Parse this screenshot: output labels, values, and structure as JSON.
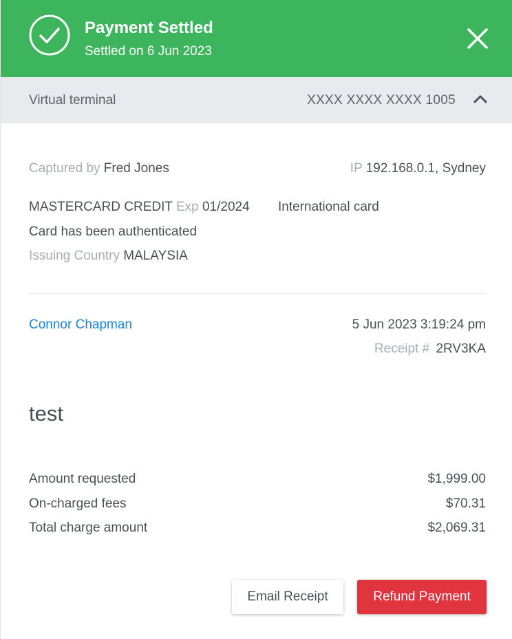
{
  "colors": {
    "header_bg": "#3cb55c",
    "bar_bg": "#e8eaed",
    "link": "#1a83e0",
    "refund_bg": "#e0343f"
  },
  "header": {
    "icon": "check-circle-icon",
    "title": "Payment Settled",
    "subtitle": "Settled on 6 Jun 2023",
    "close_icon": "close-icon"
  },
  "terminal_bar": {
    "label": "Virtual terminal",
    "card_number": "XXXX XXXX XXXX 1005",
    "toggle_icon": "chevron-up-icon"
  },
  "details": {
    "captured_by_label": "Captured by",
    "captured_by_value": "Fred Jones",
    "ip_label": "IP",
    "ip_value": "192.168.0.1, Sydney",
    "card_type": "MASTERCARD CREDIT",
    "exp_label": "Exp",
    "exp_value": "01/2024",
    "card_scope": "International card",
    "auth_status": "Card has been authenticated",
    "issuing_country_label": "Issuing Country",
    "issuing_country_value": "MALAYSIA"
  },
  "customer": {
    "name": "Connor Chapman",
    "datetime": "5 Jun 2023 3:19:24 pm",
    "receipt_label": "Receipt #",
    "receipt_value": "2RV3KA"
  },
  "note": "test",
  "amounts": [
    {
      "label": "Amount requested",
      "value": "$1,999.00"
    },
    {
      "label": "On-charged fees",
      "value": "$70.31"
    },
    {
      "label": "Total charge amount",
      "value": "$2,069.31"
    }
  ],
  "actions": {
    "email_receipt": "Email Receipt",
    "refund_payment": "Refund Payment"
  }
}
